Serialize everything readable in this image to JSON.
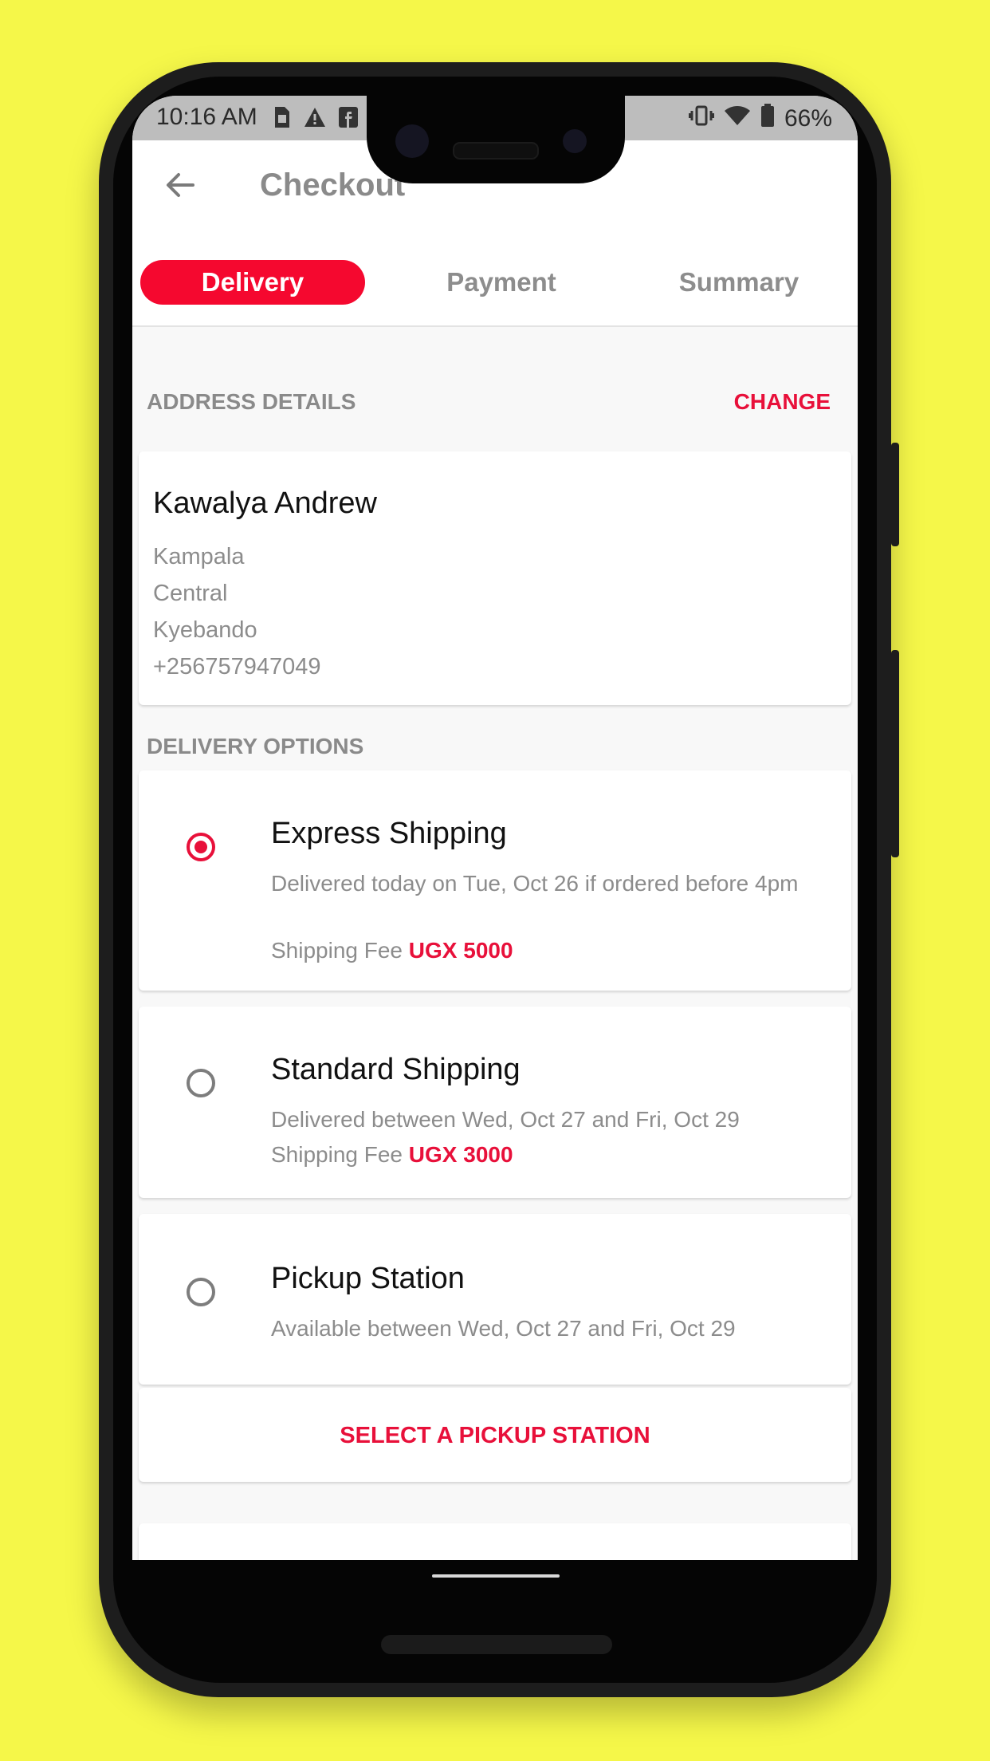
{
  "status_bar": {
    "time": "10:16 AM",
    "battery": "66%"
  },
  "appbar": {
    "title": "Checkout"
  },
  "tabs": [
    {
      "label": "Delivery",
      "active": true
    },
    {
      "label": "Payment",
      "active": false
    },
    {
      "label": "Summary",
      "active": false
    }
  ],
  "address": {
    "section_label": "ADDRESS DETAILS",
    "change_label": "CHANGE",
    "name": "Kawalya Andrew",
    "lines": [
      "Kampala",
      "Central",
      "Kyebando",
      "+256757947049"
    ]
  },
  "delivery": {
    "section_label": "DELIVERY OPTIONS",
    "options": [
      {
        "title": "Express Shipping",
        "desc": "Delivered today on Tue, Oct 26 if ordered before 4pm",
        "fee_label": "Shipping Fee",
        "fee": "UGX 5000",
        "selected": true
      },
      {
        "title": "Standard Shipping",
        "desc": "Delivered between Wed, Oct 27 and Fri, Oct 29",
        "fee_label": "Shipping Fee",
        "fee": "UGX 3000",
        "selected": false
      },
      {
        "title": "Pickup Station",
        "desc": "Available between Wed, Oct 27 and Fri, Oct 29",
        "selected": false
      }
    ],
    "pickup_button": "SELECT A PICKUP STATION"
  },
  "colors": {
    "accent": "#e8103a",
    "tab_active": "#f5082f",
    "background": "#f5f749"
  },
  "icons": [
    "sim-card-icon",
    "alert-icon",
    "facebook-icon",
    "vibrate-icon",
    "wifi-icon",
    "battery-icon",
    "back-arrow-icon"
  ]
}
